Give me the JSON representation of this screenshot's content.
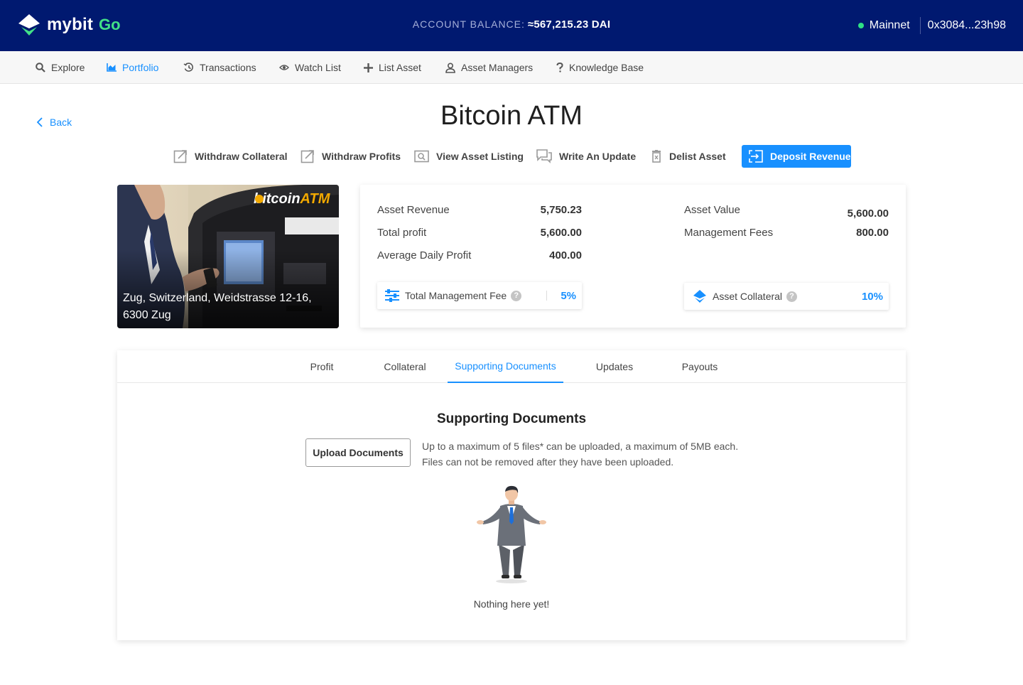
{
  "header": {
    "brand": "mybit",
    "brand_suffix": "Go",
    "balance_label": "ACCOUNT BALANCE:",
    "balance_value": "≈567,215.23 DAI",
    "network": "Mainnet",
    "address": "0x3084...23h98",
    "colors": {
      "bar": "#001970",
      "accent": "#42e087",
      "network_ok": "#2ee084"
    }
  },
  "nav": {
    "items": [
      {
        "label": "Explore",
        "icon": "search-icon"
      },
      {
        "label": "Portfolio",
        "icon": "chart-icon",
        "active": true
      },
      {
        "label": "Transactions",
        "icon": "history-icon"
      },
      {
        "label": "Watch List",
        "icon": "eye-icon"
      },
      {
        "label": "List Asset",
        "icon": "plus-icon"
      },
      {
        "label": "Asset Managers",
        "icon": "user-icon"
      },
      {
        "label": "Knowledge Base",
        "icon": "question-icon"
      }
    ]
  },
  "page": {
    "back_label": "Back",
    "title": "Bitcoin ATM",
    "actions": [
      {
        "label": "Withdraw Collateral",
        "icon": "external-edit-icon"
      },
      {
        "label": "Withdraw Profits",
        "icon": "external-edit-icon"
      },
      {
        "label": "View Asset Listing",
        "icon": "view-listing-icon"
      },
      {
        "label": "Write An Update",
        "icon": "chat-icon"
      },
      {
        "label": "Delist Asset",
        "icon": "trash-icon"
      },
      {
        "label": "Deposit Revenue",
        "icon": "deposit-icon",
        "primary": true
      }
    ],
    "accent": "#1890ff"
  },
  "asset": {
    "location": "Zug, Switzerland, Weidstrasse 12-16, 6300 Zug",
    "photo_sign": "bitcoinATM"
  },
  "stats": {
    "left": [
      {
        "label": "Asset Revenue",
        "value": "5,750.23"
      },
      {
        "label": "Total profit",
        "value": "5,600.00"
      },
      {
        "label": "Average Daily Profit",
        "value": "400.00"
      }
    ],
    "right": [
      {
        "label": "Asset Value",
        "value": "5,600.00"
      },
      {
        "label": "Management Fees",
        "value": "800.00"
      }
    ],
    "fee_card": {
      "label": "Total Management Fee",
      "value": "5%",
      "icon": "sliders-icon"
    },
    "collateral_card": {
      "label": "Asset Collateral",
      "value": "10%",
      "icon": "mybit-logo-icon"
    }
  },
  "tabs": {
    "items": [
      "Profit",
      "Collateral",
      "Supporting Documents",
      "Updates",
      "Payouts"
    ],
    "active_index": 2
  },
  "documents": {
    "title": "Supporting Documents",
    "upload_label": "Upload Documents",
    "hint_line1": "Up to a maximum of 5 files* can be uploaded, a maximum of 5MB each.",
    "hint_line2": "Files can not be removed after they have been uploaded.",
    "empty_text": "Nothing here yet!"
  }
}
